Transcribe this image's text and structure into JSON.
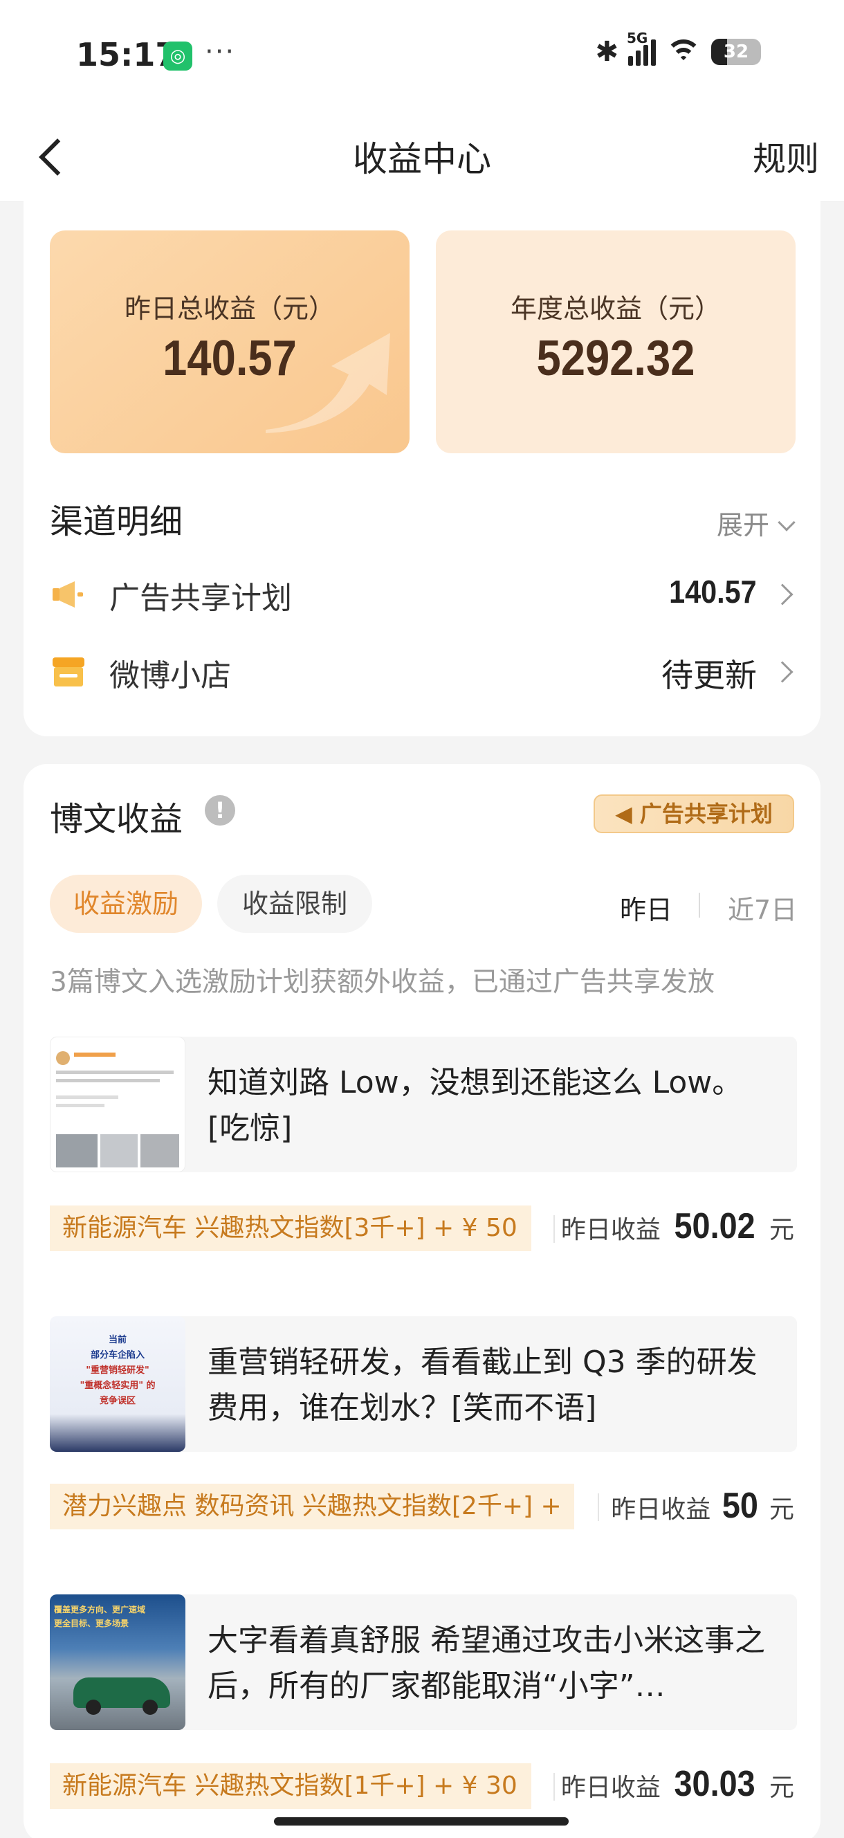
{
  "status": {
    "time": "15:17",
    "network": "5G",
    "battery": "32",
    "more": "···"
  },
  "nav": {
    "title": "收益中心",
    "rules": "规则"
  },
  "stats": [
    {
      "label": "昨日总收益（元）",
      "value": "140.57"
    },
    {
      "label": "年度总收益（元）",
      "value": "5292.32"
    }
  ],
  "channels": {
    "title": "渠道明细",
    "expand": "展开",
    "items": [
      {
        "name": "广告共享计划",
        "value": "140.57"
      },
      {
        "name": "微博小店",
        "value": "待更新"
      }
    ]
  },
  "posts_section": {
    "title": "博文收益",
    "badge": "广告共享计划",
    "tabs": [
      "收益激励",
      "收益限制"
    ],
    "periods": [
      "昨日",
      "近7日"
    ],
    "summary": "3篇博文入选激励计划获额外收益，已通过广告共享发放",
    "earn_label": "昨日收益",
    "unit": "元",
    "posts": [
      {
        "title": "知道刘路 Low，没想到还能这么 Low。[吃惊]",
        "tags": "新能源汽车 兴趣热文指数[3千+] + ¥ 50",
        "earning": "50.02"
      },
      {
        "title": "重营销轻研发，看看截止到 Q3 季的研发费用，谁在划水？[笑而不语]",
        "tags": "潜力兴趣点 数码资讯 兴趣热文指数[2千+] +",
        "earning": "50",
        "thumb_lines": [
          "当前",
          "部分车企陷入",
          "\"重营销轻研发\"",
          "\"重概念轻实用\" 的",
          "竞争误区"
        ]
      },
      {
        "title": "大字看着真舒服 希望通过攻击小米这事之后，所有的厂家都能取消“小字”…",
        "tags": "新能源汽车 兴趣热文指数[1千+] + ¥ 30",
        "earning": "30.03",
        "thumb_lines": [
          "覆盖更多方向、更广速域",
          "更全目标、更多场景"
        ]
      }
    ]
  },
  "colors": {
    "accent": "#e0862b",
    "card_warm": "#fcd9ad",
    "card_light": "#fdebd8",
    "tag_bg": "#fdf0dc"
  }
}
